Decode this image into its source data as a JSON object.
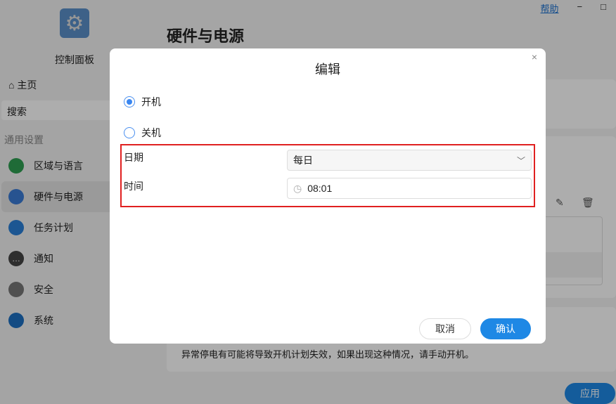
{
  "app": {
    "title": "控制面板",
    "home": "主页",
    "search_placeholder": "搜索",
    "group": "通用设置",
    "nav": [
      {
        "label": "区域与语言",
        "color": "#2f9e52"
      },
      {
        "label": "硬件与电源",
        "color": "#3a7bd5"
      },
      {
        "label": "任务计划",
        "color": "#2a7fd8"
      },
      {
        "label": "通知",
        "color": "#444"
      },
      {
        "label": "安全",
        "color": "#777"
      },
      {
        "label": "系统",
        "color": "#1c6fc1"
      }
    ]
  },
  "topbar": {
    "help": "帮助",
    "minimize": "−",
    "maximize": "□"
  },
  "main": {
    "title": "硬件与电源",
    "note": "异常停电有可能将导致开机计划失效，如果出现这种情况，请手动开机。",
    "apply": "应用"
  },
  "dialog": {
    "title": "编辑",
    "close": "×",
    "options": [
      {
        "label": "开机",
        "selected": true
      },
      {
        "label": "关机",
        "selected": false
      }
    ],
    "date_label": "日期",
    "date_value": "每日",
    "time_label": "时间",
    "time_value": "08:01",
    "cancel": "取消",
    "confirm": "确认"
  }
}
